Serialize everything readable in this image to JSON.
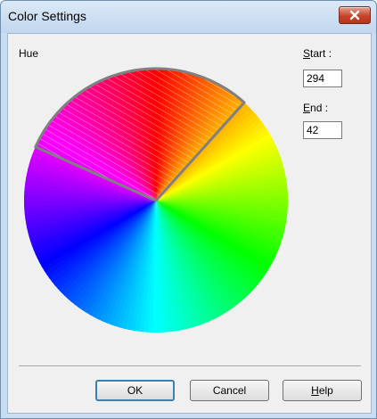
{
  "window": {
    "title": "Color Settings"
  },
  "hue": {
    "label": "Hue",
    "start": 294,
    "end": 42
  },
  "start": {
    "label_key": "S",
    "label_rest": "tart :",
    "value": "294"
  },
  "end": {
    "label_key": "E",
    "label_rest": "nd :",
    "value": "42"
  },
  "buttons": {
    "ok": "OK",
    "cancel": "Cancel",
    "help_key": "H",
    "help_rest": "elp"
  },
  "icons": {
    "close": "close-icon"
  },
  "colors": {
    "selection_border": "#808080",
    "hatch": "#ffffff",
    "ok_focus": "#3c7fb1"
  }
}
